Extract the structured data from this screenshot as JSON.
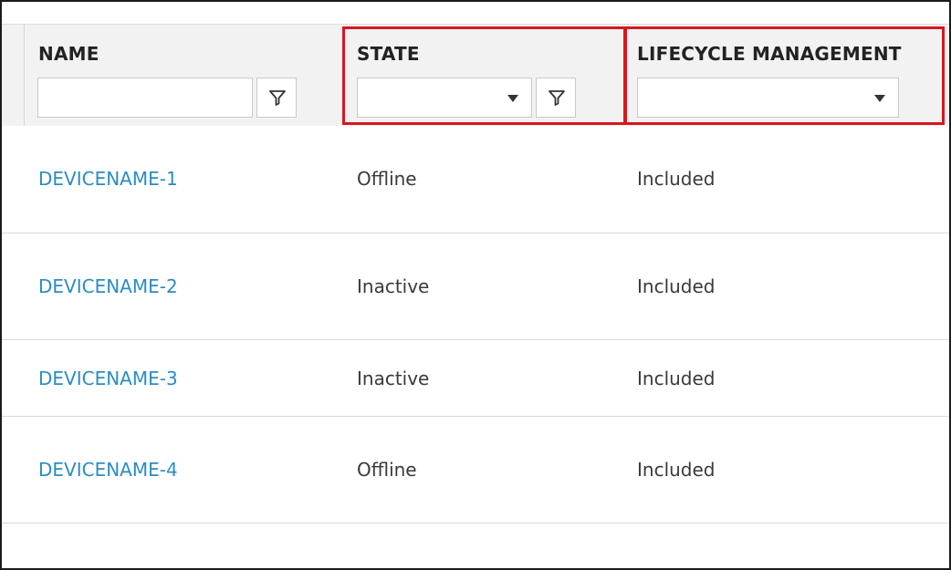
{
  "table": {
    "columns": {
      "name": {
        "header": "NAME",
        "filter_value": "",
        "filter_icon": "funnel-icon"
      },
      "state": {
        "header": "STATE",
        "selected_value": "",
        "dropdown_icon": "caret-down-icon",
        "filter_icon": "funnel-icon"
      },
      "lifecycle": {
        "header": "LIFECYCLE MANAGEMENT",
        "selected_value": "",
        "dropdown_icon": "caret-down-icon"
      }
    },
    "rows": [
      {
        "name": "DEVICENAME-1",
        "state": "Offline",
        "lifecycle": "Included"
      },
      {
        "name": "DEVICENAME-2",
        "state": "Inactive",
        "lifecycle": "Included"
      },
      {
        "name": "DEVICENAME-3",
        "state": "Inactive",
        "lifecycle": "Included"
      },
      {
        "name": "DEVICENAME-4",
        "state": "Offline",
        "lifecycle": "Included"
      }
    ]
  },
  "colors": {
    "link": "#2b8cc4",
    "highlight": "#d7161e",
    "header_bg": "#f2f2f2"
  }
}
